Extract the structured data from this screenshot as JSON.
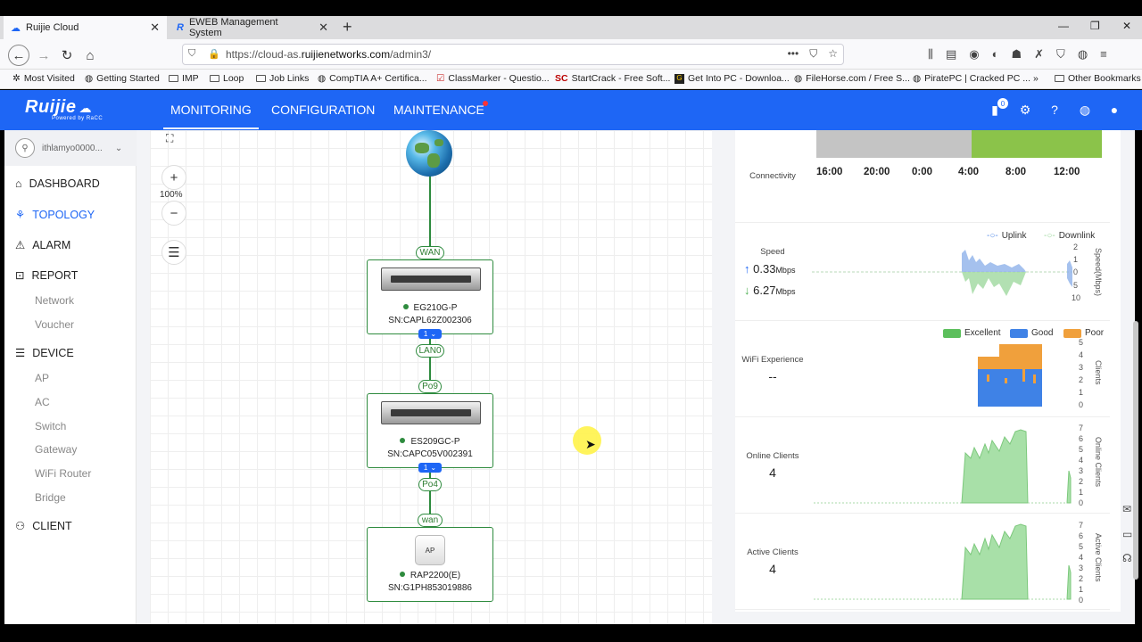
{
  "browser": {
    "tabs": [
      {
        "label": "Ruijie Cloud",
        "active": true
      },
      {
        "label": "EWEB Management System",
        "active": false
      }
    ],
    "url_prefix": "https://cloud-as.",
    "url_domain": "ruijienetworks.com",
    "url_path": "/admin3/",
    "bookmarks": [
      "Most Visited",
      "Getting Started",
      "IMP",
      "Loop",
      "Job Links",
      "CompTIA A+ Certifica...",
      "ClassMarker - Questio...",
      "StartCrack - Free Soft...",
      "Get Into PC - Downloa...",
      "FileHorse.com / Free S...",
      "PiratePC | Cracked PC ...",
      "Other Bookmarks"
    ],
    "bookmark_prefix_sc": "SC"
  },
  "app": {
    "logo": "Ruijie",
    "logo_sub": "Powered by RaCC",
    "nav": [
      "MONITORING",
      "CONFIGURATION",
      "MAINTENANCE"
    ],
    "notif_count": "0"
  },
  "sidebar": {
    "user": "ithlamyo0000...",
    "items": {
      "dashboard": "DASHBOARD",
      "topology": "TOPOLOGY",
      "alarm": "ALARM",
      "report": "REPORT",
      "device": "DEVICE",
      "client": "CLIENT"
    },
    "report_sub": [
      "Network",
      "Voucher"
    ],
    "device_sub": [
      "AP",
      "AC",
      "Switch",
      "Gateway",
      "WiFi Router",
      "Bridge"
    ]
  },
  "topology": {
    "zoom": "100%",
    "ports": {
      "wan": "WAN",
      "lan0": "LAN0",
      "po9": "Po9",
      "po4": "Po4",
      "wan2": "wan"
    },
    "nodes": [
      {
        "model": "EG210G-P",
        "sn": "SN:CAPL62Z002306",
        "badge": "1"
      },
      {
        "model": "ES209GC-P",
        "sn": "SN:CAPC05V002391",
        "badge": "1"
      },
      {
        "model": "RAP2200(E)",
        "sn": "SN:G1PH853019886",
        "icon_text": "AP"
      }
    ]
  },
  "panel": {
    "connectivity": {
      "label": "Connectivity",
      "times": [
        "16:00",
        "20:00",
        "0:00",
        "4:00",
        "8:00",
        "12:00"
      ],
      "offline_color": "#c4c4c4",
      "online_color": "#8bc34a"
    },
    "speed": {
      "label": "Speed",
      "up": "0.33",
      "down": "6.27",
      "unit": "Mbps",
      "legend_up": "Uplink",
      "legend_down": "Downlink",
      "axis": "Speed(Mbps)",
      "ticks": [
        "2",
        "1",
        "0",
        "5",
        "10"
      ]
    },
    "wifi": {
      "label": "WiFi Experience",
      "value": "--",
      "legend": [
        "Excellent",
        "Good",
        "Poor"
      ],
      "colors": [
        "#5cbf5c",
        "#3f82e6",
        "#f0a03c"
      ],
      "axis": "Clients",
      "ticks": [
        "5",
        "4",
        "3",
        "2",
        "1",
        "0"
      ]
    },
    "online": {
      "label": "Online Clients",
      "value": "4",
      "axis": "Online Clients",
      "ticks": [
        "7",
        "6",
        "5",
        "4",
        "3",
        "2",
        "1",
        "0"
      ]
    },
    "active": {
      "label": "Active Clients",
      "value": "4",
      "axis": "Active Clients",
      "ticks": [
        "7",
        "6",
        "5",
        "4",
        "3",
        "2",
        "1",
        "0"
      ]
    }
  }
}
